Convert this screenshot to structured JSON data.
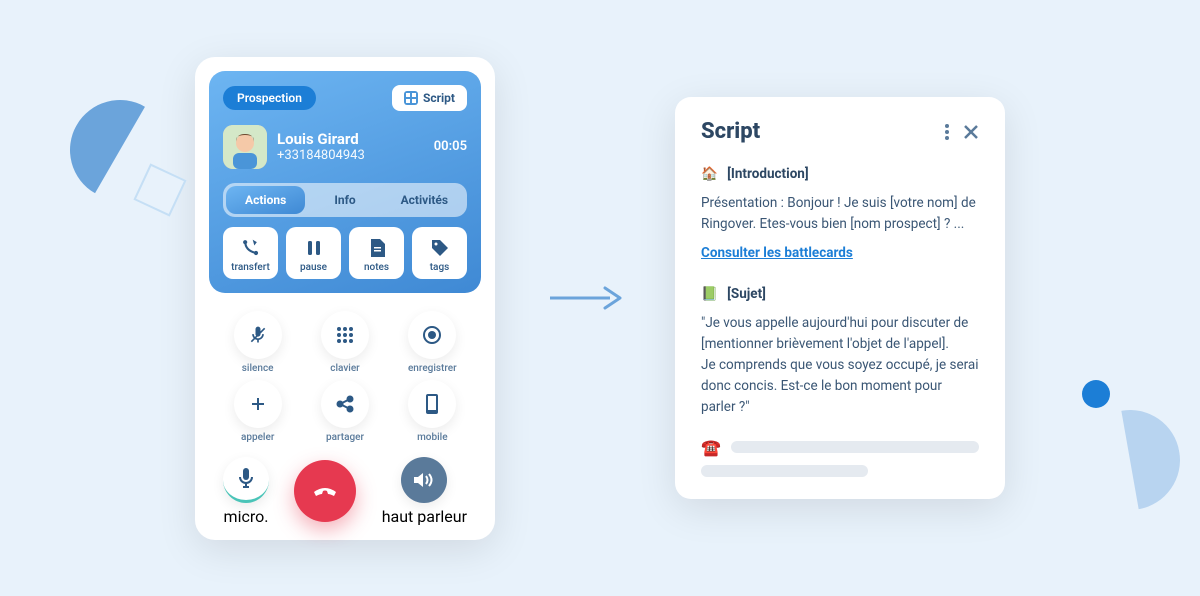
{
  "call": {
    "tag": "Prospection",
    "script_button": "Script",
    "caller_name": "Louis Girard",
    "caller_number": "+33184804943",
    "timer": "00:05",
    "tabs": [
      "Actions",
      "Info",
      "Activités"
    ],
    "active_tab": 0,
    "actions": [
      {
        "id": "transfert",
        "label": "transfert"
      },
      {
        "id": "pause",
        "label": "pause"
      },
      {
        "id": "notes",
        "label": "notes"
      },
      {
        "id": "tags",
        "label": "tags"
      }
    ],
    "controls": [
      {
        "id": "silence",
        "label": "silence"
      },
      {
        "id": "clavier",
        "label": "clavier"
      },
      {
        "id": "enregistrer",
        "label": "enregistrer"
      },
      {
        "id": "appeler",
        "label": "appeler"
      },
      {
        "id": "partager",
        "label": "partager"
      },
      {
        "id": "mobile",
        "label": "mobile"
      }
    ],
    "bottom": {
      "micro": "micro.",
      "speaker": "haut parleur"
    }
  },
  "script": {
    "title": "Script",
    "sections": {
      "intro": {
        "emoji": "🏠",
        "title": "[Introduction]",
        "body": "Présentation : Bonjour ! Je suis [votre nom] de Ringover. Etes-vous bien [nom prospect] ? ...",
        "link": "Consulter les battlecards"
      },
      "sujet": {
        "emoji": "📗",
        "title": "[Sujet]",
        "body": "\"Je vous appelle aujourd'hui pour discuter de [mentionner brièvement l'objet de l'appel].\nJe comprends que vous soyez occupé, je serai donc concis. Est-ce le bon moment pour parler ?\""
      },
      "phone_emoji": "☎️"
    }
  }
}
